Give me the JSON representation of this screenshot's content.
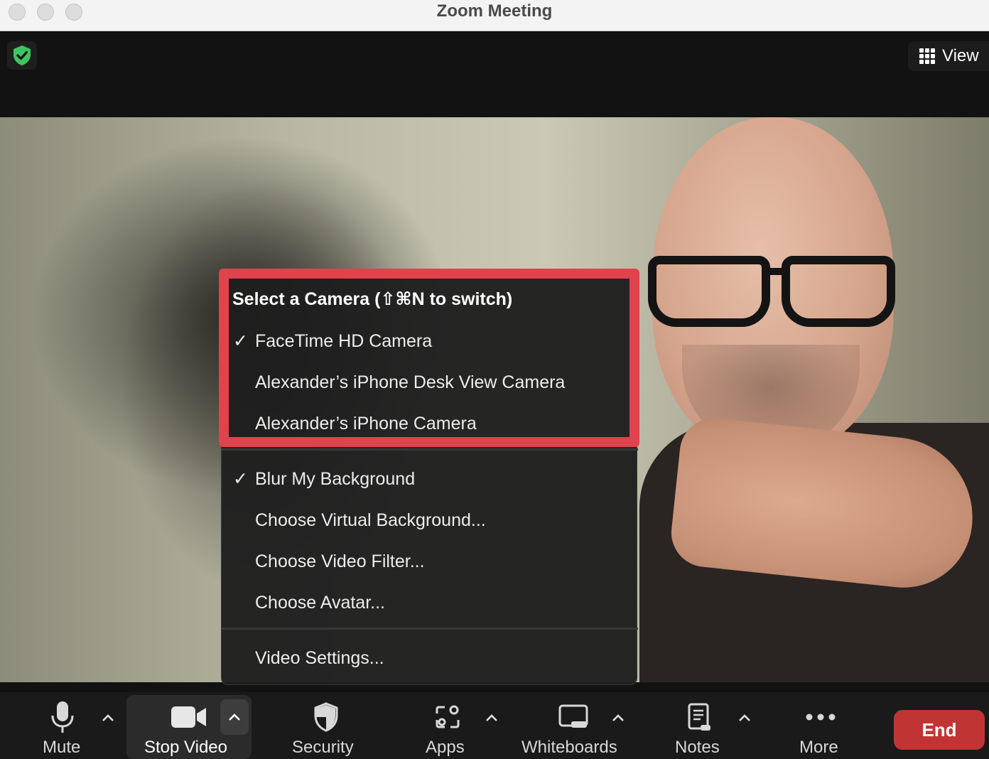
{
  "window": {
    "title": "Zoom Meeting"
  },
  "top_bar": {
    "security_badge_icon": "green-shield-check-icon",
    "view_label": "View",
    "view_icon": "grid-icon"
  },
  "camera_menu": {
    "header": "Select a Camera (⇧⌘N to switch)",
    "cameras": [
      {
        "label": "FaceTime HD Camera",
        "checked": true
      },
      {
        "label": "Alexander’s iPhone Desk View Camera",
        "checked": false
      },
      {
        "label": "Alexander’s iPhone Camera",
        "checked": false
      }
    ],
    "background_options": [
      {
        "label": "Blur My Background",
        "checked": true
      },
      {
        "label": "Choose Virtual Background...",
        "checked": false
      },
      {
        "label": "Choose Video Filter...",
        "checked": false
      },
      {
        "label": "Choose Avatar...",
        "checked": false
      }
    ],
    "settings_label": "Video Settings...",
    "check_glyph": "✓",
    "highlight_color": "#e0434b"
  },
  "toolbar": {
    "mute_label": "Mute",
    "stop_video_label": "Stop Video",
    "security_label": "Security",
    "apps_label": "Apps",
    "whiteboards_label": "Whiteboards",
    "notes_label": "Notes",
    "more_label": "More",
    "end_label": "End",
    "end_color": "#c03533",
    "caret_glyph": "^"
  }
}
